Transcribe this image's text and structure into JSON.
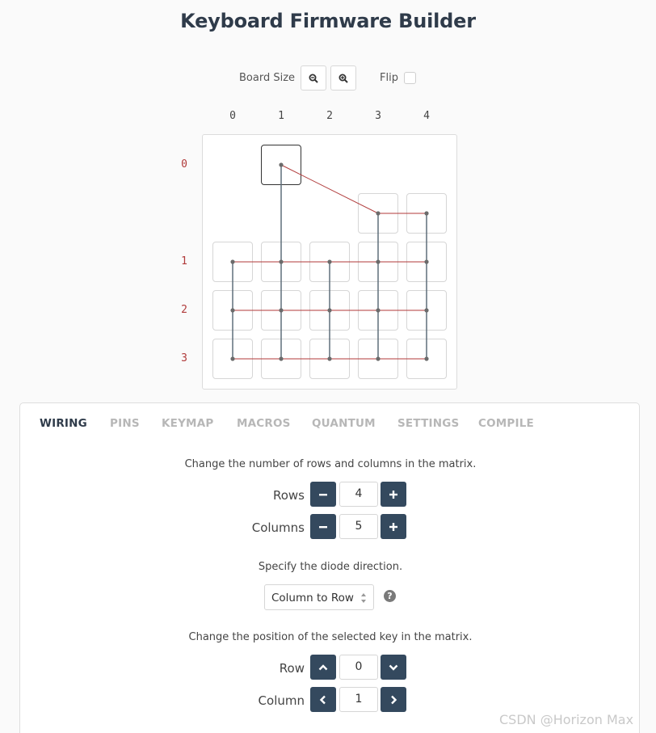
{
  "app": {
    "title": "Keyboard Firmware Builder"
  },
  "board_controls": {
    "board_size_label": "Board Size",
    "zoom_out_icon": "zoom-out-icon",
    "zoom_in_icon": "zoom-in-icon",
    "flip_label": "Flip",
    "flip_checked": false
  },
  "matrix": {
    "column_labels": [
      "0",
      "1",
      "2",
      "3",
      "4"
    ],
    "row_labels": [
      "0",
      "1",
      "2",
      "3"
    ],
    "row_wire_color": "#b03a3a",
    "column_wire_color": "#5f6f7a",
    "selected_key": {
      "row": 0,
      "column": 1
    }
  },
  "tabs": [
    {
      "label": "WIRING",
      "active": true
    },
    {
      "label": "PINS",
      "active": false
    },
    {
      "label": "KEYMAP",
      "active": false
    },
    {
      "label": "MACROS",
      "active": false
    },
    {
      "label": "QUANTUM",
      "active": false
    },
    {
      "label": "SETTINGS",
      "active": false
    },
    {
      "label": "COMPILE",
      "active": false
    }
  ],
  "wiring": {
    "matrix_size_text": "Change the number of rows and columns in the matrix.",
    "rows_label": "Rows",
    "rows_value": "4",
    "columns_label": "Columns",
    "columns_value": "5",
    "diode_text": "Specify the diode direction.",
    "diode_value": "Column to Row",
    "help_glyph": "?",
    "position_text": "Change the position of the selected key in the matrix.",
    "row_label": "Row",
    "row_value": "0",
    "column_label": "Column",
    "column_value": "1"
  },
  "colors": {
    "accent": "#34495e",
    "title": "#2f3b4a",
    "inactive_tab": "#b7b7b7"
  },
  "watermark": "CSDN @Horizon Max"
}
